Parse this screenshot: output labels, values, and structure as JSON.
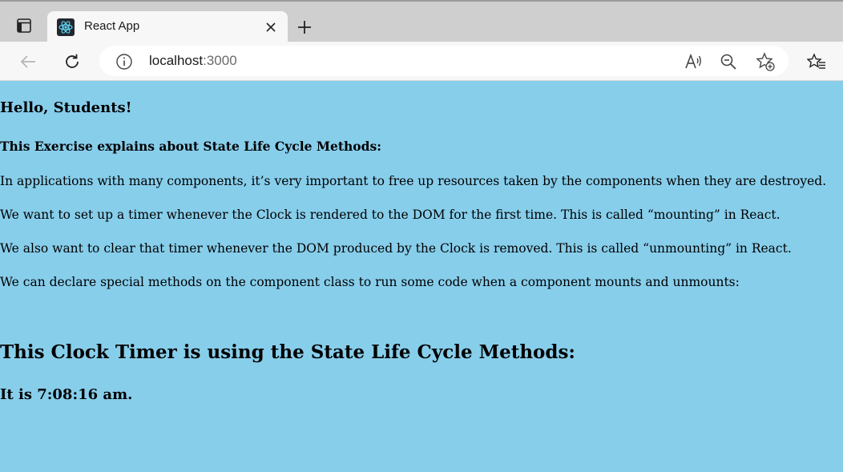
{
  "browser": {
    "tab_title": "React App",
    "url_host": "localhost",
    "url_port": ":3000"
  },
  "page": {
    "greeting": "Hello, Students!",
    "subheading": "This Exercise explains about State Life Cycle Methods:",
    "paragraphs": [
      "In applications with many components, it’s very important to free up resources taken by the components when they are destroyed.",
      "We want to set up a timer whenever the Clock is rendered to the DOM for the first time. This is called “mounting” in React.",
      "We also want to clear that timer whenever the DOM produced by the Clock is removed. This is called “unmounting” in React.",
      "We can declare special methods on the component class to run some code when a component mounts and unmounts:"
    ],
    "clock_heading": "This Clock Timer is using the State Life Cycle Methods:",
    "clock_time": "It is 7:08:16 am."
  },
  "colors": {
    "page_background": "#87ceeb",
    "react_logo": "#61dafb"
  },
  "icons": {
    "tab_actions": "tab-actions-icon",
    "favicon": "react-logo-icon",
    "close": "close-icon",
    "new_tab": "plus-icon",
    "back": "back-arrow-icon",
    "refresh": "refresh-icon",
    "info": "info-icon",
    "read_aloud": "read-aloud-icon",
    "zoom_out": "zoom-out-icon",
    "add_favorite": "add-favorite-icon",
    "favorites": "favorites-icon"
  }
}
